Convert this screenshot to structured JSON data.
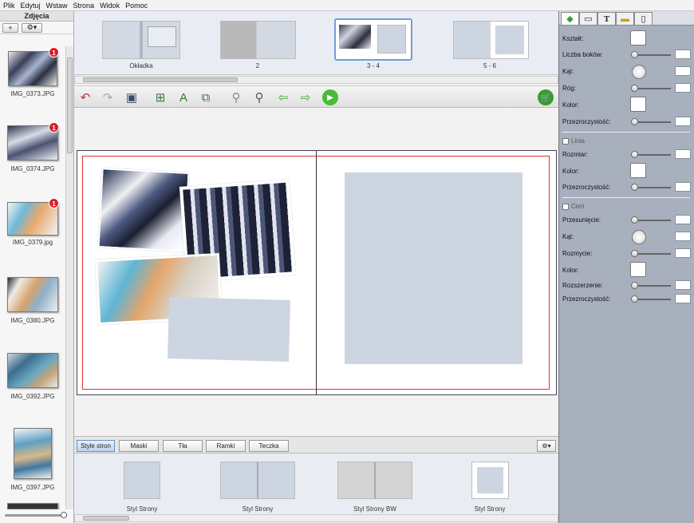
{
  "menu": [
    "Plik",
    "Edytuj",
    "Wstaw",
    "Strona",
    "Widok",
    "Pomoc"
  ],
  "left_panel": {
    "title": "Zdjęcia",
    "add_label": "+",
    "photos": [
      {
        "name": "IMG_0373.JPG",
        "badge": "1"
      },
      {
        "name": "IMG_0374.JPG",
        "badge": "1"
      },
      {
        "name": "IMG_0379.jpg",
        "badge": "1"
      },
      {
        "name": "IMG_0380.JPG",
        "badge": ""
      },
      {
        "name": "IMG_0392.JPG",
        "badge": ""
      },
      {
        "name": "IMG_0397.JPG",
        "badge": ""
      }
    ]
  },
  "pages": [
    {
      "label": "Okładka"
    },
    {
      "label": "2"
    },
    {
      "label": "3 - 4"
    },
    {
      "label": "5 - 6"
    }
  ],
  "bottom_tabs": [
    "Style stron",
    "Maski",
    "Tła",
    "Ramki",
    "Teczka"
  ],
  "styles": [
    {
      "label": "Styl Strony"
    },
    {
      "label": "Styl Strony"
    },
    {
      "label": "Styl Strony BW"
    },
    {
      "label": "Styl Strony"
    }
  ],
  "properties": {
    "shape_label": "Kształt:",
    "sides_label": "Liczba boków:",
    "angle_label": "Kąt:",
    "corner_label": "Róg:",
    "color_label": "Kolor:",
    "opacity_label": "Przezroczystość:",
    "line_label": "Linia",
    "size_label": "Rozmiar:",
    "line_color_label": "Kolor:",
    "line_opacity_label": "Przezroczystość:",
    "shadow_label": "Cień",
    "offset_label": "Przesunięcie:",
    "shadow_angle_label": "Kąt:",
    "blur_label": "Rozmycie:",
    "shadow_color_label": "Kolor:",
    "spread_label": "Rozszerzenie:",
    "shadow_opacity_label": "Przezroczystość:"
  },
  "colors": {
    "accent": "#5b8ed6",
    "badge": "#d81f26",
    "placeholder": "#cdd5e1",
    "cart": "#3b9a2f"
  }
}
